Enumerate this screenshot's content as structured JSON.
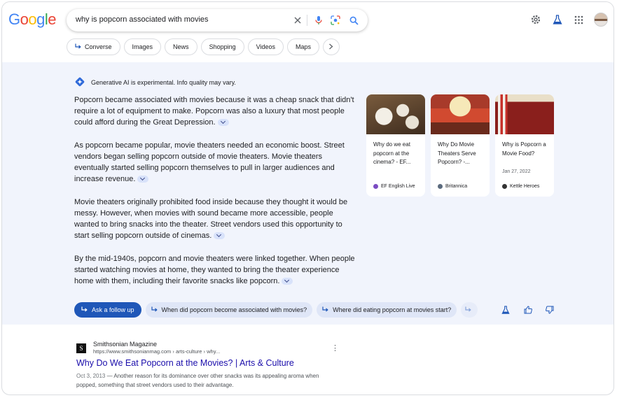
{
  "search": {
    "query": "why is popcorn associated with movies"
  },
  "logo": {
    "letters": [
      "G",
      "o",
      "o",
      "g",
      "l",
      "e"
    ],
    "colors": [
      "#4285f4",
      "#ea4335",
      "#fbbc05",
      "#4285f4",
      "#34a853",
      "#ea4335"
    ]
  },
  "chips": [
    {
      "label": "Converse",
      "icon": "follow-up-arrow-icon"
    },
    {
      "label": "Images"
    },
    {
      "label": "News"
    },
    {
      "label": "Shopping"
    },
    {
      "label": "Videos"
    },
    {
      "label": "Maps"
    }
  ],
  "ai_overview": {
    "notice": "Generative AI is experimental. Info quality may vary.",
    "paragraphs": [
      "Popcorn became associated with movies because it was a cheap snack that didn't require a lot of equipment to make. Popcorn was also a luxury that most people could afford during the Great Depression.",
      "As popcorn became popular, movie theaters needed an economic boost. Street vendors began selling popcorn outside of movie theaters. Movie theaters eventually started selling popcorn themselves to pull in larger audiences and increase revenue.",
      "Movie theaters originally prohibited food inside because they thought it would be messy. However, when movies with sound became more accessible, people wanted to bring snacks into the theater. Street vendors used this opportunity to start selling popcorn outside of cinemas.",
      "By the mid-1940s, popcorn and movie theaters were linked together. When people started watching movies at home, they wanted to bring the theater experience home with them, including their favorite snacks like popcorn."
    ],
    "cards": [
      {
        "title": "Why do we eat popcorn at the cinema? - EF...",
        "date": "",
        "source": "EF English Live",
        "source_color": "#7b4cc2"
      },
      {
        "title": "Why Do Movie Theaters Serve Popcorn? -...",
        "date": "",
        "source": "Britannica",
        "source_color": "#5b6b7e"
      },
      {
        "title": "Why is Popcorn a Movie Food?",
        "date": "Jan 27, 2022",
        "source": "Kettle Heroes",
        "source_color": "#333333"
      }
    ],
    "followups": {
      "primary": "Ask a follow up",
      "suggestions": [
        "When did popcorn become associated with movies?",
        "Where did eating popcorn at movies start?"
      ]
    }
  },
  "result": {
    "site_name": "Smithsonian Magazine",
    "site_url": "https://www.smithsonianmag.com › arts-culture › why...",
    "favicon_letter": "S",
    "title": "Why Do We Eat Popcorn at the Movies? | Arts & Culture",
    "date": "Oct 3, 2013",
    "snippet": " — Another reason for its dominance over other snacks was its appealing aroma when popped, something that street vendors used to their advantage."
  }
}
